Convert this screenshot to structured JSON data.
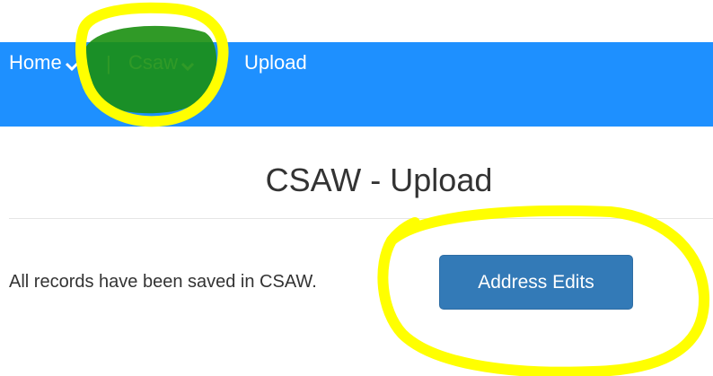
{
  "navbar": {
    "items": [
      {
        "label": "Home",
        "icon": "chevron-down-icon"
      },
      {
        "label": "Csaw",
        "icon": "chevron-down-icon"
      },
      {
        "label": "Upload"
      }
    ],
    "separator": "|",
    "background_color": "#1e90ff"
  },
  "page": {
    "title": "CSAW - Upload"
  },
  "main": {
    "status_message": "All records have been saved in CSAW.",
    "address_edits_label": "Address Edits",
    "button_color": "#337ab7"
  },
  "annotations": {
    "marker_colors": [
      "#ffff00",
      "#1a8f10"
    ]
  }
}
